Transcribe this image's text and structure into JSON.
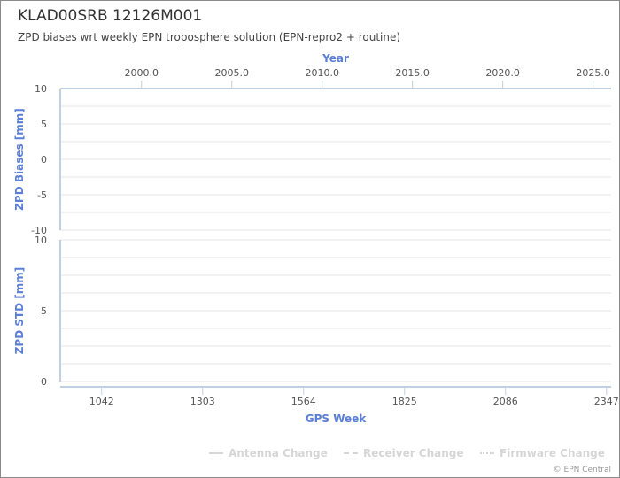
{
  "title": "KLAD00SRB 12126M001",
  "subtitle": "ZPD biases wrt weekly EPN troposphere solution (EPN-repro2 + routine)",
  "credits": "© EPN Central",
  "chart_data": {
    "type": "line",
    "top_axis": {
      "title": "Year",
      "ticks": [
        "2000.0",
        "2005.0",
        "2010.0",
        "2015.0",
        "2020.0",
        "2025.0"
      ],
      "range": [
        1995.5,
        2026.0
      ]
    },
    "bottom_axis": {
      "title": "GPS Week",
      "ticks": [
        "1042",
        "1303",
        "1564",
        "1825",
        "2086",
        "2347"
      ],
      "range": [
        935,
        2359
      ]
    },
    "panels": [
      {
        "ylabel": "ZPD Biases [mm]",
        "ylim": [
          -10,
          10
        ],
        "yticks": [
          "10",
          "5",
          "0",
          "-5",
          "-10"
        ],
        "grid": true,
        "series": []
      },
      {
        "ylabel": "ZPD STD [mm]",
        "ylim": [
          0,
          10
        ],
        "yticks": [
          "10",
          "5",
          "0"
        ],
        "grid": true,
        "series": []
      }
    ],
    "legend": {
      "placement": "bottom-right",
      "items": [
        {
          "label": "Antenna Change",
          "style": "solid",
          "color": "#d6d6d6"
        },
        {
          "label": "Receiver Change",
          "style": "dashed",
          "color": "#d6d6d6"
        },
        {
          "label": "Firmware Change",
          "style": "dotted",
          "color": "#d6d6d6"
        }
      ]
    }
  }
}
